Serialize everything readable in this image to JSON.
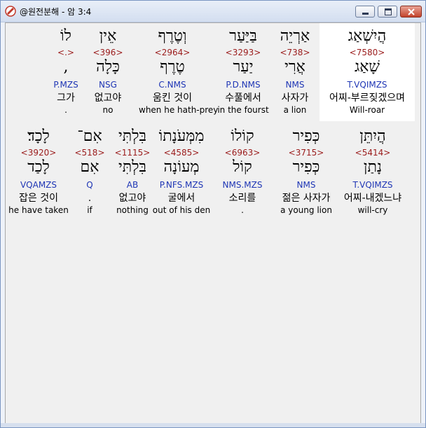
{
  "window": {
    "title": "@원전분해 - 암 3:4"
  },
  "row1": [
    {
      "surface": "הֲיִשְׁאַג",
      "strong": "<7580>",
      "lemma": "שָׁאַג",
      "parse": "T.VQIMZS",
      "kor": "어찌-부르짖겠으며",
      "eng": "Will-roar",
      "highlight": true
    },
    {
      "surface": "אַרְיֵה",
      "strong": "<738>",
      "lemma": "אֲרִי",
      "parse": "NMS",
      "kor": "사자가",
      "eng": "a lion",
      "highlight": false
    },
    {
      "surface": "בַּיַּעַר",
      "strong": "<3293>",
      "lemma": "יַעַר",
      "parse": "P.D.NMS",
      "kor": "수풀에서",
      "eng": "in the fourst",
      "highlight": false
    },
    {
      "surface": "וְטֶרֶף",
      "strong": "<2964>",
      "lemma": "טֶרֶף",
      "parse": "C.NMS",
      "kor": "움킨 것이",
      "eng": "when he hath-prey",
      "highlight": false
    },
    {
      "surface": "אֵין",
      "strong": "<396>",
      "lemma": "כָּלָה",
      "parse": "NSG",
      "kor": "없고야",
      "eng": "no",
      "highlight": false
    },
    {
      "surface": "לוֹ",
      "strong": "<.>",
      "lemma": ",",
      "parse": "P.MZS",
      "kor": "그가",
      "eng": ".",
      "highlight": false
    }
  ],
  "row2": [
    {
      "surface": "הֲיִתֵּן",
      "strong": "<5414>",
      "lemma": "נָתַן",
      "parse": "T.VQIMZS",
      "kor": "어찌-내겠느냐",
      "eng": "will-cry"
    },
    {
      "surface": "כְּפִיר",
      "strong": "<3715>",
      "lemma": "כְּפִיר",
      "parse": "NMS",
      "kor": "젊은 사자가",
      "eng": "a young lion"
    },
    {
      "surface": "קוֹלוֹ",
      "strong": "<6963>",
      "lemma": "קוֹל",
      "parse": "NMS.MZS",
      "kor": "소리를",
      "eng": "."
    },
    {
      "surface": "מִמְּעֹנָתוֹ",
      "strong": "<4585>",
      "lemma": "מְעוֹנָה",
      "parse": "P.NFS.MZS",
      "kor": "굴에서",
      "eng": "out of his den"
    },
    {
      "surface": "בִּלְתִּי",
      "strong": "<1115>",
      "lemma": "בִּלְתִּי",
      "parse": "AB",
      "kor": "없고야",
      "eng": "nothing"
    },
    {
      "surface": "אִם־",
      "strong": "<518>",
      "lemma": "אִם",
      "parse": "Q",
      "kor": ".",
      "eng": "if"
    },
    {
      "surface": "לָכָד׃",
      "strong": "<3920>",
      "lemma": "לָכַד",
      "parse": "VQAMZS",
      "kor": "잡은 것이",
      "eng": "he have taken"
    }
  ]
}
